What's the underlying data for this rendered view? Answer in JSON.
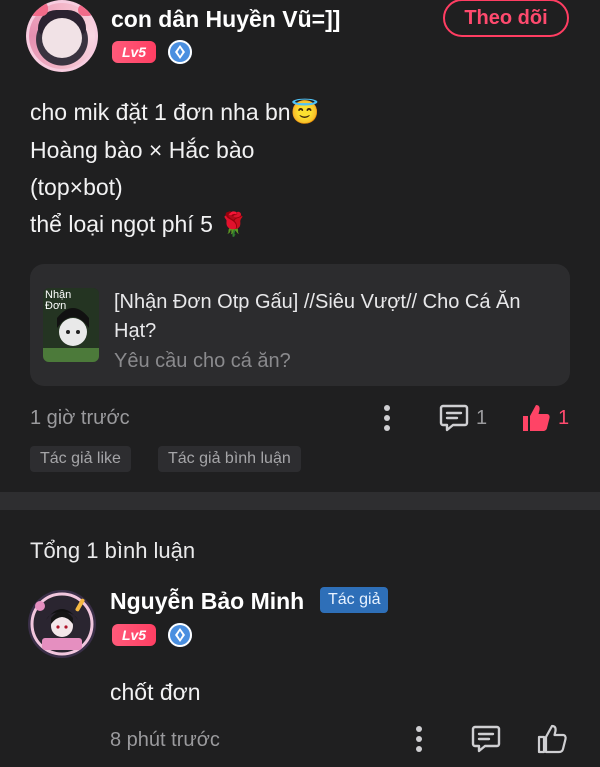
{
  "post": {
    "author": "con dân Huyền Vũ=]]",
    "level": "Lv5",
    "follow_label": "Theo dõi",
    "content_lines": [
      "cho mik đặt 1 đơn nha bn",
      "Hoàng bào × Hắc bào",
      "(top×bot)",
      "thể loại ngọt phí 5"
    ],
    "emoji_halo": "😇",
    "emoji_rose": "🌹",
    "linked_card": {
      "title": "[Nhận Đơn Otp Gấu] //Siêu Vượt// Cho Cá Ăn Hạt?",
      "subtitle": "Yêu cầu cho cá ăn?",
      "thumb_text": "Nhận Đơn"
    },
    "time": "1 giờ trước",
    "comment_count": "1",
    "like_count": "1",
    "tags": [
      "Tác giả like",
      "Tác giả bình luận"
    ]
  },
  "comments_section": {
    "title": "Tổng 1 bình luận",
    "items": [
      {
        "author": "Nguyễn Bảo Minh",
        "author_tag": "Tác giả",
        "level": "Lv5",
        "text": "chốt đơn",
        "time": "8 phút trước"
      }
    ]
  },
  "colors": {
    "background": "#1f1f20",
    "accent": "#ff3d62",
    "author_tag": "#2e6fb8"
  }
}
